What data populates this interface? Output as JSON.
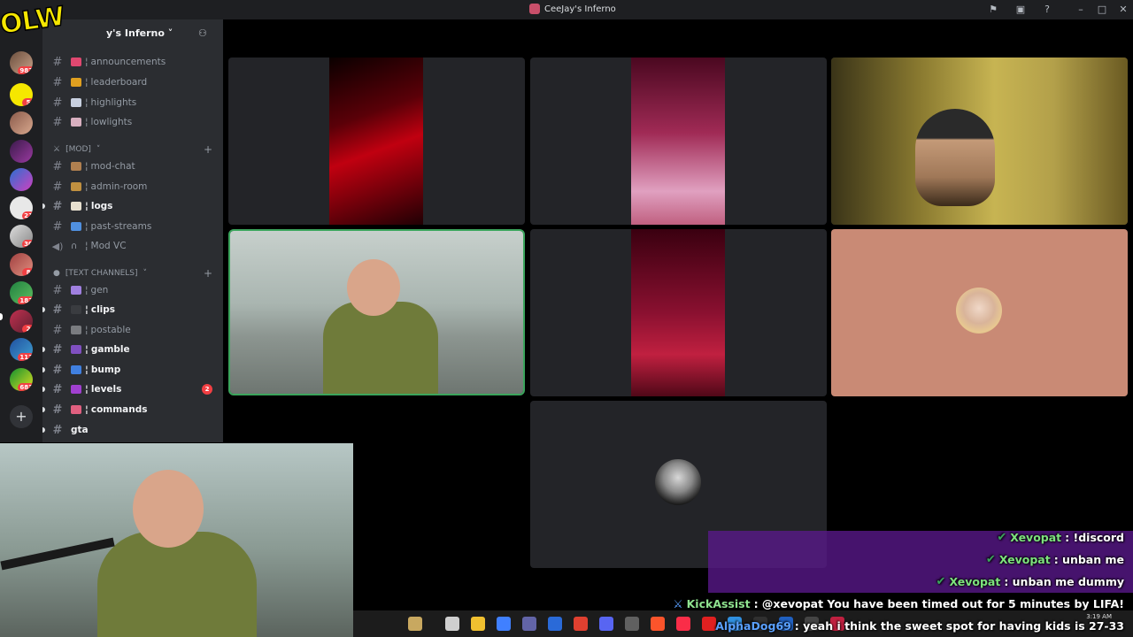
{
  "window": {
    "title": "CeeJay's Inferno"
  },
  "logo": {
    "text": "OLW"
  },
  "server": {
    "name": "y's Inferno ˅"
  },
  "rail_badges": [
    "982",
    "5",
    "21",
    "30",
    "8",
    "182",
    "2",
    "112",
    "683"
  ],
  "channels_top": [
    {
      "label": "announcements"
    },
    {
      "label": "leaderboard"
    },
    {
      "label": "highlights"
    },
    {
      "label": "lowlights"
    }
  ],
  "categories": {
    "mod": "[MOD]",
    "text": "[TEXT CHANNELS]"
  },
  "channels_mod": [
    {
      "label": "mod-chat"
    },
    {
      "label": "admin-room"
    },
    {
      "label": "logs"
    },
    {
      "label": "past-streams"
    },
    {
      "label": "Mod VC"
    }
  ],
  "channels_text": [
    {
      "label": "gen"
    },
    {
      "label": "clips"
    },
    {
      "label": "postable"
    },
    {
      "label": "gamble"
    },
    {
      "label": "bump"
    },
    {
      "label": "levels",
      "badge": "2"
    },
    {
      "label": "commands"
    },
    {
      "label": "gta"
    }
  ],
  "chat": [
    {
      "user": "Xevopat",
      "text": ": !discord"
    },
    {
      "user": "Xevopat",
      "text": ": unban me"
    },
    {
      "user": "Xevopat",
      "text": ": unban me dummy"
    },
    {
      "user": "KickAssist",
      "text": ": @xevopat You have been timed out for 5 minutes by LIFA!"
    },
    {
      "user": "AlphaDog69",
      "text": ": yeah i think the sweet spot for having kids is 27-33"
    }
  ],
  "clock": {
    "time": "3:19 AM",
    "date": ""
  },
  "colors": {
    "sidebar": "#2b2d31",
    "rail": "#1e1f22",
    "speaking": "#3ba55c",
    "chat_band": "#5a188c",
    "peach": "#c98a75"
  }
}
